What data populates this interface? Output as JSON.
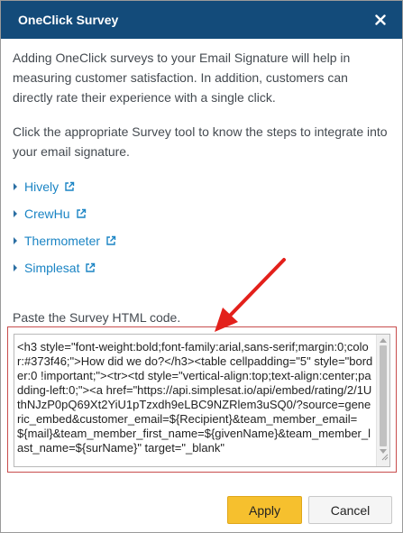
{
  "dialog": {
    "title": "OneClick Survey",
    "close_icon": "close-icon"
  },
  "intro": {
    "paragraph1": "Adding OneClick surveys to your Email Signature will help in measuring customer satisfaction. In addition, customers can directly rate their experience with a single click.",
    "paragraph2": "Click the appropriate Survey tool to know the steps to integrate into your email signature."
  },
  "survey_tools": [
    {
      "label": "Hively",
      "icon": "external-link-icon"
    },
    {
      "label": "CrewHu",
      "icon": "external-link-icon"
    },
    {
      "label": "Thermometer",
      "icon": "external-link-icon"
    },
    {
      "label": "Simplesat",
      "icon": "external-link-icon"
    }
  ],
  "paste": {
    "label": "Paste the Survey HTML code.",
    "code": "<h3 style=\"font-weight:bold;font-family:arial,sans-serif;margin:0;color:#373f46;\">How did we do?</h3><table cellpadding=\"5\" style=\"border:0 !important;\"><tr><td style=\"vertical-align:top;text-align:center;padding-left:0;\"><a href=\"https://api.simplesat.io/api/embed/rating/2/1UthNJzP0pQ69Xt2YiU1pTzxdh9eLBC9NZRlem3uSQ0/?source=generic_embed&customer_email=${Recipient}&team_member_email=${mail}&team_member_first_name=${givenName}&team_member_last_name=${surName}\" target=\"_blank\""
  },
  "footer": {
    "apply_label": "Apply",
    "cancel_label": "Cancel"
  },
  "colors": {
    "header_bg": "#134b7a",
    "link": "#1a84c4",
    "apply_bg": "#f6c02e",
    "highlight_border": "#c84d4d",
    "annotation_arrow": "#e3201b"
  }
}
